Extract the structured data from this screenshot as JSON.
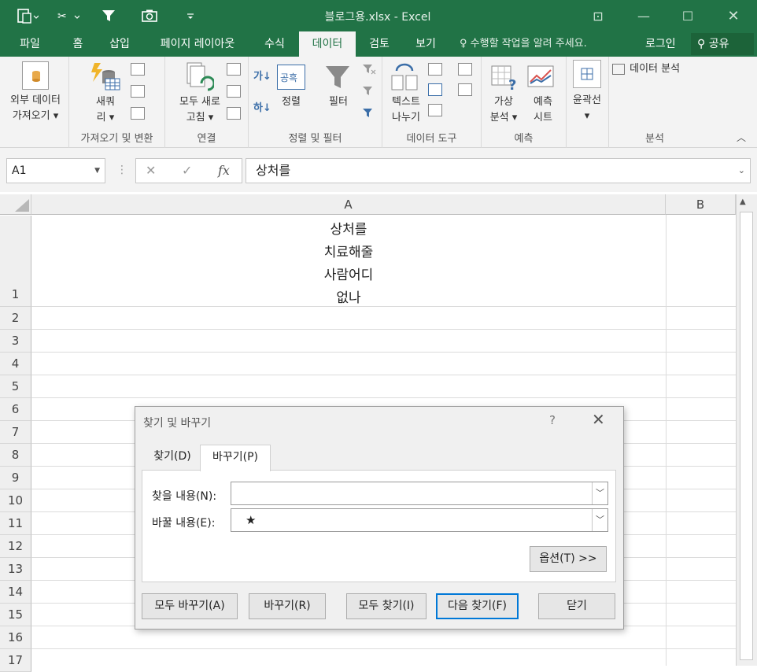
{
  "window": {
    "title": "블로그용.xlsx - Excel",
    "minimize": "—",
    "restore": "☐",
    "close": "✕",
    "ribbon_display": "⊡"
  },
  "tabs": [
    "파일",
    "홈",
    "삽입",
    "페이지 레이아웃",
    "수식",
    "데이터",
    "검토",
    "보기"
  ],
  "active_tab": "데이터",
  "tell_me": "수행할 작업을 알려 주세요.",
  "login": "로그인",
  "share": "공유",
  "ribbon": {
    "get_external_data": "외부 데이터",
    "get_external_data_2": "가져오기",
    "new_query": "새쿼",
    "new_query_2": "리",
    "group_get_transform": "가져오기 및 변환",
    "refresh_all": "모두 새로",
    "refresh_all_2": "고침",
    "group_connections": "연결",
    "sort": "정렬",
    "filter": "필터",
    "group_sort_filter": "정렬 및 필터",
    "text_to_columns": "텍스트",
    "text_to_columns_2": "나누기",
    "group_data_tools": "데이터 도구",
    "what_if": "가상",
    "what_if_2": "분석",
    "forecast_sheet": "예측",
    "forecast_sheet_2": "시트",
    "group_forecast": "예측",
    "outline": "윤곽선",
    "data_analysis": "데이터 분석",
    "group_analysis": "분석",
    "sort_az": "가↓",
    "sort_za": "하↓"
  },
  "formula_bar": {
    "name_box": "A1",
    "cancel": "✕",
    "enter": "✓",
    "fx": "fx",
    "content": "상처를"
  },
  "columns": [
    "A",
    "B"
  ],
  "rows": [
    "1",
    "2",
    "3",
    "4",
    "5",
    "6",
    "7",
    "8",
    "9",
    "10",
    "11",
    "12",
    "13",
    "14",
    "15",
    "16",
    "17"
  ],
  "cell_a1_lines": [
    "상처를",
    "치료해줄",
    "사람어디",
    "없나"
  ],
  "dialog": {
    "title": "찾기 및 바꾸기",
    "help": "?",
    "close": "✕",
    "tab_find": "찾기(D)",
    "tab_replace": "바꾸기(P)",
    "find_label": "찾을 내용(N):",
    "find_value": "",
    "replace_label": "바꿀 내용(E):",
    "replace_value": "★",
    "options_button": "옵션(T) >>",
    "replace_all": "모두 바꾸기(A)",
    "replace": "바꾸기(R)",
    "find_all": "모두 찾기(I)",
    "find_next": "다음 찾기(F)",
    "close_button": "닫기"
  }
}
